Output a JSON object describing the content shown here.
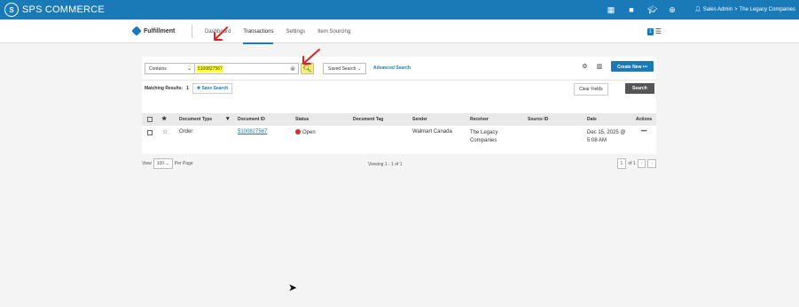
{
  "topbar": {
    "logo_text": "SPS COMMERCE",
    "user_label": "Sales Admin",
    "company": "The Legacy Companies",
    "separator": ">"
  },
  "app": {
    "name": "Fulfillment",
    "tabs": [
      "Dashboard",
      "Transactions",
      "Settings",
      "Item Sourcing"
    ],
    "active_tab": "Transactions",
    "badge": "1"
  },
  "search": {
    "mode": "Contains",
    "value": "5100827567",
    "saved_search": "Saved Search",
    "advanced": "Advanced Search",
    "create_new": "Create New"
  },
  "results": {
    "matching_label": "Matching Results:",
    "matching_count": "1",
    "save_search": "Save Search",
    "clear_fields": "Clear Fields",
    "search_button": "Search"
  },
  "table": {
    "headers": [
      "Document Type",
      "Document ID",
      "Status",
      "Document Tag",
      "Sender",
      "Receiver",
      "Source ID",
      "Date",
      "Actions"
    ],
    "rows": [
      {
        "type": "Order",
        "id": "5100827567",
        "status": "Open",
        "tag": "",
        "sender": "Walmart Canada",
        "receiver": "The Legacy Companies",
        "source_id": "",
        "date": "Dec 15, 2025 @ 5:08 AM",
        "actions": "•••"
      }
    ]
  },
  "footer": {
    "view_label": "View",
    "per_page_value": "100",
    "per_page_label": "Per Page",
    "viewing": "Viewing 1 - 1 of 1",
    "page": "1",
    "of": "of 1"
  },
  "colors": {
    "brand": "#1a7ab8",
    "highlight": "#ffff3a",
    "annotation": "#e02020",
    "status_open": "#d32f2f"
  }
}
